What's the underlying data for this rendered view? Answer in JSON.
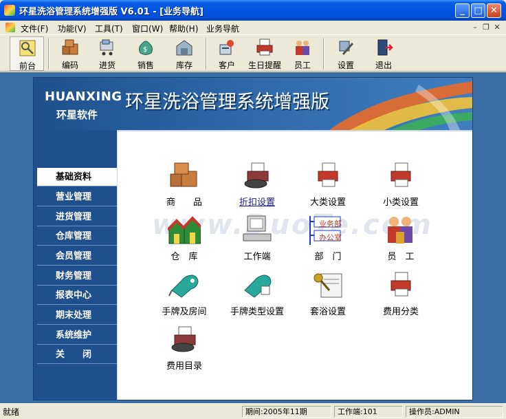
{
  "window": {
    "title": "环星洗浴管理系统增强版 V6.01 - [业务导航]",
    "controls": {
      "minimize": "_",
      "maximize": "□",
      "close": "✕"
    }
  },
  "menubar": {
    "items": [
      "文件(F)",
      "功能(V)",
      "工具(T)",
      "窗口(W)",
      "帮助(H)",
      "业务导航"
    ],
    "mdi_controls": [
      "–",
      "❐",
      "✕"
    ]
  },
  "toolbar": {
    "items": [
      {
        "label": "前台",
        "icon": "key-icon",
        "active": true
      },
      {
        "label": "编码",
        "icon": "boxes-icon"
      },
      {
        "label": "进货",
        "icon": "cart-icon"
      },
      {
        "label": "销售",
        "icon": "money-bag-icon"
      },
      {
        "label": "库存",
        "icon": "warehouse-icon"
      },
      {
        "label": "客户",
        "icon": "customer-icon"
      },
      {
        "label": "生日提醒",
        "icon": "birthday-printer-icon"
      },
      {
        "label": "员工",
        "icon": "staff-icon"
      },
      {
        "label": "设置",
        "icon": "settings-tools-icon"
      },
      {
        "label": "退出",
        "icon": "exit-door-icon"
      }
    ]
  },
  "banner": {
    "brand_en": "HUANXING",
    "brand_cn": "环星软件",
    "title": "环星洗浴管理系统增强版"
  },
  "nav": {
    "items": [
      "基础资料",
      "营业管理",
      "进货管理",
      "仓库管理",
      "会员管理",
      "财务管理",
      "报表中心",
      "期末处理",
      "系统维护",
      "关　　闭"
    ],
    "active_index": 0
  },
  "modules": [
    {
      "label": "商　　品",
      "icon": "goods-boxes-icon"
    },
    {
      "label": "折扣设置",
      "icon": "discount-printer-icon",
      "link": true
    },
    {
      "label": "大类设置",
      "icon": "category-printer-icon"
    },
    {
      "label": "小类设置",
      "icon": "subcategory-printer-icon"
    },
    {
      "label": "仓　库",
      "icon": "warehouse-houses-icon"
    },
    {
      "label": "工作端",
      "icon": "computer-terminal-icon"
    },
    {
      "label": "部　门",
      "icon": "department-tree-icon",
      "tags": [
        "业务部",
        "办公室"
      ]
    },
    {
      "label": "员　工",
      "icon": "staff-people-icon"
    },
    {
      "label": "手牌及房间",
      "icon": "key-tag-icon"
    },
    {
      "label": "手牌类型设置",
      "icon": "key-tag-type-icon"
    },
    {
      "label": "套浴设置",
      "icon": "package-keys-icon"
    },
    {
      "label": "费用分类",
      "icon": "fee-category-printer-icon"
    },
    {
      "label": "费用目录",
      "icon": "fee-catalog-icon"
    }
  ],
  "statusbar": {
    "status": "就绪",
    "period": "期间:2005年11期",
    "terminal": "工作端:101",
    "operator": "操作员:ADMIN"
  },
  "colors": {
    "titlebar": "#0054e3",
    "mdi_bg": "#3a6ea5",
    "nav_bg": "#1f4f8c",
    "link": "#1a1a8c"
  }
}
